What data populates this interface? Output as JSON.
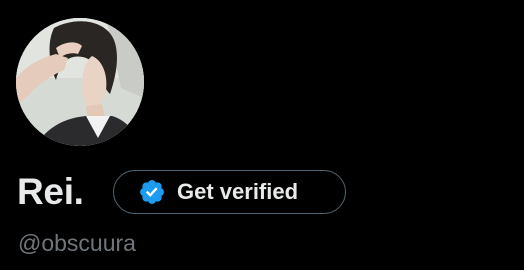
{
  "profile": {
    "display_name": "Rei.",
    "handle": "@obscuura",
    "avatar_alt": "profile photo"
  },
  "verify_button": {
    "label": "Get verified",
    "icon": "verified-badge-icon",
    "icon_color": "#1d9bf0",
    "border_color": "#536471"
  },
  "colors": {
    "background": "#000000",
    "primary_text": "#e7e9ea",
    "secondary_text": "#71767b",
    "accent": "#1d9bf0"
  }
}
